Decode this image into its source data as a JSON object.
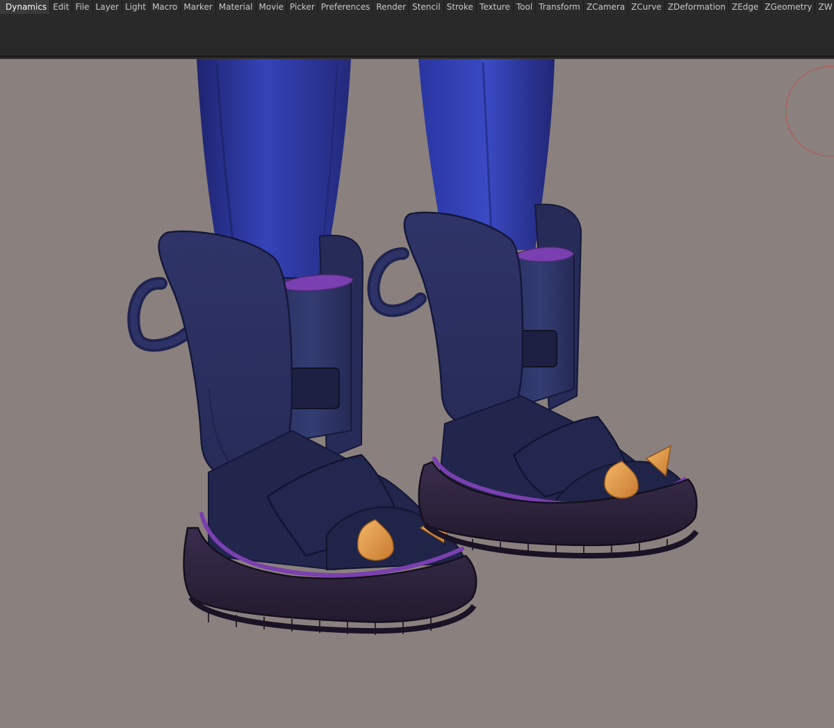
{
  "menu": {
    "items": [
      {
        "label": "Dynamics",
        "id": "dynamics"
      },
      {
        "label": "Edit",
        "id": "edit"
      },
      {
        "label": "File",
        "id": "file"
      },
      {
        "label": "Layer",
        "id": "layer"
      },
      {
        "label": "Light",
        "id": "light"
      },
      {
        "label": "Macro",
        "id": "macro"
      },
      {
        "label": "Marker",
        "id": "marker"
      },
      {
        "label": "Material",
        "id": "material"
      },
      {
        "label": "Movie",
        "id": "movie"
      },
      {
        "label": "Picker",
        "id": "picker"
      },
      {
        "label": "Preferences",
        "id": "preferences"
      },
      {
        "label": "Render",
        "id": "render"
      },
      {
        "label": "Stencil",
        "id": "stencil"
      },
      {
        "label": "Stroke",
        "id": "stroke"
      },
      {
        "label": "Texture",
        "id": "texture"
      },
      {
        "label": "Tool",
        "id": "tool"
      },
      {
        "label": "Transform",
        "id": "transform"
      },
      {
        "label": "ZCamera",
        "id": "zcamera"
      },
      {
        "label": "ZCurve",
        "id": "zcurve"
      },
      {
        "label": "ZDeformation",
        "id": "zdeformation"
      },
      {
        "label": "ZEdge",
        "id": "zedge"
      },
      {
        "label": "ZGeometry",
        "id": "zgeometry"
      },
      {
        "label": "ZW",
        "id": "zw"
      }
    ]
  },
  "colors": {
    "menubar_bg": "#2a2a2a",
    "menu_text": "#c9c9c9",
    "viewport_bg": "#8a807d",
    "pants": "#2c3a9a",
    "boot_body": "#2b2f5a",
    "boot_dark": "#1e1f3a",
    "sole": "#2a2236",
    "trim": "#7a3fb0",
    "spike": "#e09a45",
    "navigator_ring": "#c0504a"
  }
}
